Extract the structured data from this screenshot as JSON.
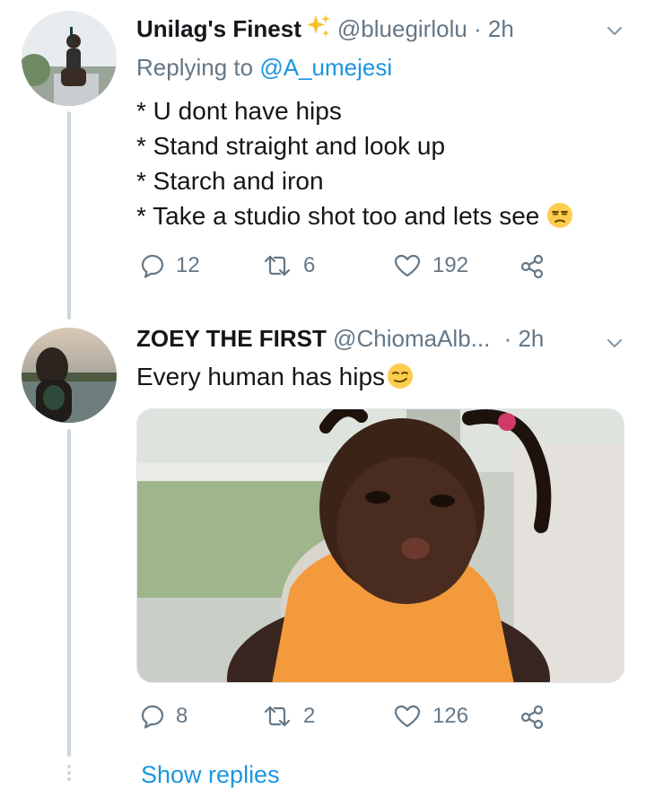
{
  "tweets": [
    {
      "display_name": "Unilag's Finest",
      "handle": "@bluegirlolu",
      "time": "· 2h",
      "replying_prefix": "Replying to",
      "replying_to": "@A_umejesi",
      "lines": [
        "* U dont have hips",
        "* Stand straight and look up",
        "* Starch and iron",
        "* Take a studio shot too and lets see"
      ],
      "icons": [
        "sparkles-icon",
        "unamused-face-emoji"
      ],
      "replies": "12",
      "retweets": "6",
      "likes": "192"
    },
    {
      "display_name": "ZOEY THE FIRST",
      "handle": "@ChiomaAlb...",
      "time": "· 2h",
      "text": "Every human has hips",
      "icons": [
        "smirking-face-emoji"
      ],
      "replies": "8",
      "retweets": "2",
      "likes": "126"
    }
  ],
  "show_replies": "Show replies",
  "colors": {
    "link": "#1b95e0",
    "muted": "#657786",
    "thread": "#ccd6dd"
  }
}
